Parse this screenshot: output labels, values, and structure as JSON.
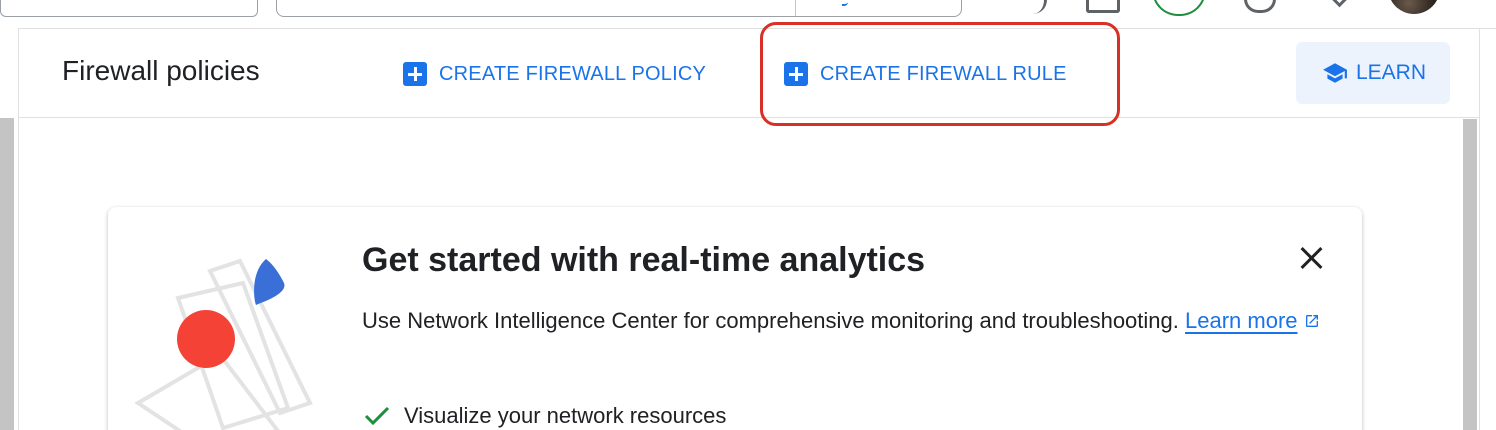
{
  "header": {
    "title": "Firewall policies",
    "actions": {
      "create_policy_label": "CREATE FIREWALL POLICY",
      "create_rule_label": "CREATE FIREWALL RULE",
      "learn_label": "LEARN"
    }
  },
  "promo_card": {
    "title": "Get started with real-time analytics",
    "description": "Use Network Intelligence Center for comprehensive monitoring and troubleshooting.",
    "link_label": "Learn more",
    "features": [
      "Visualize your network resources"
    ]
  },
  "colors": {
    "accent": "#1a73e8",
    "highlight": "#d93025",
    "check": "#1e8e3e",
    "illustration_red": "#f44336",
    "illustration_blue": "#3b6fd8"
  },
  "icons": {
    "plus": "add-box-icon",
    "learn": "school-icon",
    "close": "close-icon",
    "external": "open-in-new-icon",
    "check": "check-icon"
  }
}
